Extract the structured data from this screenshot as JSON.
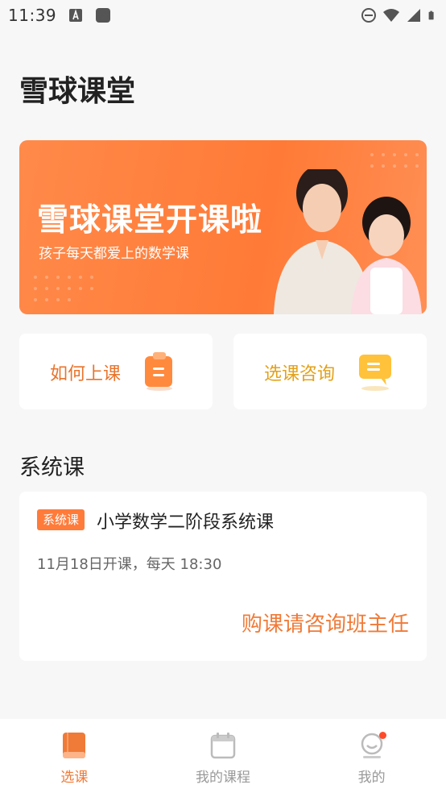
{
  "status_bar": {
    "time": "11:39"
  },
  "header": {
    "title": "雪球课堂"
  },
  "banner": {
    "title": "雪球课堂开课啦",
    "subtitle": "孩子每天都爱上的数学课"
  },
  "quick_links": [
    {
      "label": "如何上课",
      "icon": "clipboard-icon",
      "color": "#e8742c"
    },
    {
      "label": "选课咨询",
      "icon": "chat-bubble-icon",
      "color": "#e3a11a"
    }
  ],
  "section": {
    "title": "系统课"
  },
  "course": {
    "tag": "系统课",
    "name": "小学数学二阶段系统课",
    "schedule": "11月18日开课，每天 18:30",
    "cta": "购课请咨询班主任"
  },
  "tabbar": {
    "items": [
      {
        "label": "选课",
        "icon": "book-icon",
        "active": true
      },
      {
        "label": "我的课程",
        "icon": "calendar-icon",
        "active": false
      },
      {
        "label": "我的",
        "icon": "profile-face-icon",
        "active": false
      }
    ]
  },
  "colors": {
    "accent": "#f07a37",
    "banner": "#ff7a36",
    "consult": "#e3a11a",
    "badge": "#ff4a2a"
  }
}
